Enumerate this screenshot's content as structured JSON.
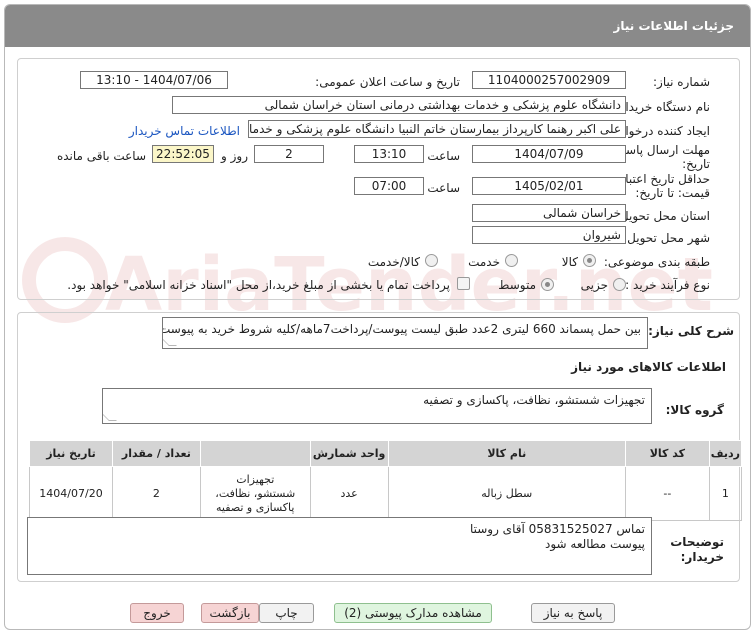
{
  "header": {
    "title": "جزئیات اطلاعات نیاز"
  },
  "fields": {
    "need_number_label": "شماره نیاز:",
    "need_number": "1104000257002909",
    "announce_label": "تاریخ و ساعت اعلان عمومی:",
    "announce_value": "1404/07/06 - 13:10",
    "buyer_label": "نام دستگاه خریدار:",
    "buyer_value": "دانشگاه علوم پزشکی و خدمات بهداشتی درمانی استان خراسان شمالی",
    "requester_label": "ایجاد کننده درخواست:",
    "requester_value": "علی اکبر رهنما کارپرداز بیمارستان خاتم النبیا دانشگاه علوم پزشکی و خدمات بهداشتی",
    "contact_link": "اطلاعات تماس خریدار",
    "deadline_label_1": "مهلت ارسال پاسخ: تا",
    "deadline_label_2": "تاریخ:",
    "deadline_date": "1404/07/09",
    "time_word": "ساعت",
    "deadline_time": "13:10",
    "days_value": "2",
    "days_word": "روز و",
    "remaining_time": "22:52:05",
    "remaining_word": "ساعت باقی مانده",
    "validity_label_1": "حداقل تاریخ اعتبار",
    "validity_label_2": "قیمت: تا تاریخ:",
    "validity_date": "1405/02/01",
    "validity_time": "07:00",
    "province_label": "استان محل تحویل:",
    "province_value": "خراسان شمالی",
    "city_label": "شهر محل تحویل:",
    "city_value": "شیروان",
    "category_label": "طبقه بندی موضوعی:",
    "category_options": [
      "کالا",
      "خدمت",
      "کالا/خدمت"
    ],
    "process_label": "نوع فرآیند خرید :",
    "process_options": [
      "جزیی",
      "متوسط"
    ],
    "payment_note": "پرداخت تمام یا بخشی از مبلغ خرید،از محل \"اسناد خزانه اسلامی\" خواهد بود."
  },
  "description": {
    "label": "شرح کلی نیاز:",
    "value": "بین حمل پسماند 660 لیتری 2عدد طبق لیست پیوست/پرداخت7ماهه/کلیه شروط خرید به پیوست می باشد"
  },
  "goods": {
    "section_title": "اطلاعات کالاهای مورد نیاز",
    "group_label": "گروه کالا:",
    "group_value": "تجهیزات شستشو، نظافت، پاکسازی و تصفیه"
  },
  "table": {
    "headers": [
      "ردیف",
      "کد کالا",
      "نام کالا",
      "واحد شمارش",
      "تعداد / مقدار",
      "تاریخ نیاز"
    ],
    "rows": [
      {
        "row": "1",
        "code": "--",
        "name": "سطل زباله",
        "unit": "عدد",
        "qty": "2",
        "date": "1404/07/20"
      }
    ],
    "side_text": [
      "تجهیزات",
      "شستشو، نظافت،",
      "پاکسازی و تصفیه"
    ]
  },
  "buyer_notes": {
    "label_1": "توضیحات",
    "label_2": "خریدار:",
    "line1": "تماس 05831525027 آقای روستا",
    "line2": "پیوست مطالعه شود"
  },
  "buttons": {
    "reply": "پاسخ به نیاز",
    "view_docs": "مشاهده مدارک پیوستی (2)",
    "print": "چاپ",
    "back": "بازگشت",
    "exit": "خروج"
  },
  "watermark": "AriaTender.net",
  "colors": {
    "header": "#8a8a8a",
    "yellow": "#fbf6c8",
    "link": "#1a55c0"
  }
}
